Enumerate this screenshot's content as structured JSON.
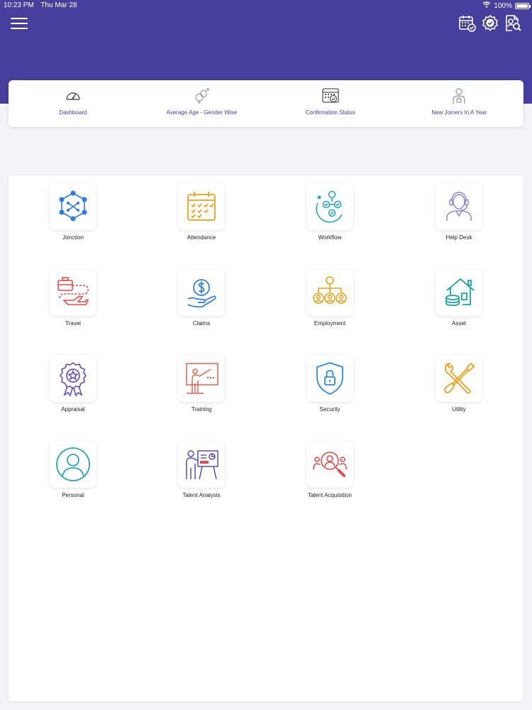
{
  "status": {
    "time": "10:23 PM",
    "date": "Thu Mar 28",
    "battery": "100%"
  },
  "top_actions": [
    {
      "name": "calendar-check-icon"
    },
    {
      "name": "verified-badge-icon"
    },
    {
      "name": "document-search-icon"
    }
  ],
  "tabs": [
    {
      "label": "Dashboard",
      "icon": "speedometer-icon"
    },
    {
      "label": "Average Age - Gender Wise",
      "icon": "gender-icon"
    },
    {
      "label": "Confirmation Status",
      "icon": "calendar-check-icon"
    },
    {
      "label": "New Joiners In A Year",
      "icon": "new-joiner-icon"
    }
  ],
  "modules": [
    {
      "label": "Jonction",
      "icon": "network-people-icon",
      "color": "#2a7de1"
    },
    {
      "label": "Attendance",
      "icon": "calendar-icon",
      "color": "#f0a018"
    },
    {
      "label": "Workflow",
      "icon": "workflow-icon",
      "color": "#2aa7b8"
    },
    {
      "label": "Help Desk",
      "icon": "support-agent-icon",
      "color": "#8f86d6"
    },
    {
      "label": "Travel",
      "icon": "travel-icon",
      "color": "#e84a4a"
    },
    {
      "label": "Claims",
      "icon": "dollar-hand-icon",
      "color": "#2a7de1"
    },
    {
      "label": "Employment",
      "icon": "org-chart-icon",
      "color": "#f0a018"
    },
    {
      "label": "Asset",
      "icon": "house-coins-icon",
      "color": "#1aa3a3"
    },
    {
      "label": "Appraisal",
      "icon": "award-badge-icon",
      "color": "#6b55c0"
    },
    {
      "label": "Training",
      "icon": "presenter-board-icon",
      "color": "#e86050"
    },
    {
      "label": "Security",
      "icon": "shield-lock-icon",
      "color": "#2a8de1"
    },
    {
      "label": "Utility",
      "icon": "tools-icon",
      "color": "#f0a018"
    },
    {
      "label": "Personal",
      "icon": "person-circle-icon",
      "color": "#2aa7b8"
    },
    {
      "label": "Talent Analysis",
      "icon": "presentation-chart-icon",
      "color": "#5a4fb0"
    },
    {
      "label": "Talent Acquisition",
      "icon": "search-people-icon",
      "color": "#e84a4a"
    }
  ]
}
